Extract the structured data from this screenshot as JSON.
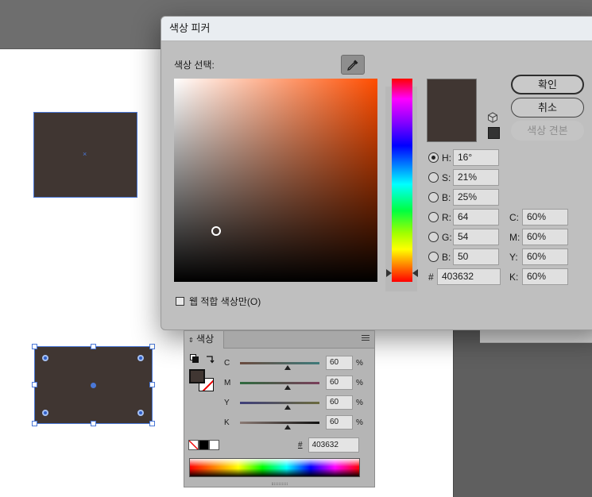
{
  "dialog": {
    "title": "색상 피커",
    "select_label": "색상 선택:",
    "ok_label": "확인",
    "cancel_label": "취소",
    "swatches_label": "색상 견본",
    "current_color": "#403632",
    "web_only_label": "웹 적합 색상만(O)",
    "fields": {
      "h": {
        "label": "H:",
        "value": "16°"
      },
      "s": {
        "label": "S:",
        "value": "21%"
      },
      "b": {
        "label": "B:",
        "value": "25%"
      },
      "r": {
        "label": "R:",
        "value": "64"
      },
      "g": {
        "label": "G:",
        "value": "54"
      },
      "bl": {
        "label": "B:",
        "value": "50"
      },
      "c": {
        "label": "C:",
        "value": "60%"
      },
      "m": {
        "label": "M:",
        "value": "60%"
      },
      "y": {
        "label": "Y:",
        "value": "60%"
      },
      "k": {
        "label": "K:",
        "value": "60%"
      },
      "hex": {
        "label": "#",
        "value": "403632"
      }
    }
  },
  "color_panel": {
    "tab_label": "색상",
    "sliders": [
      {
        "label": "C",
        "value": "60",
        "unit": "%"
      },
      {
        "label": "M",
        "value": "60",
        "unit": "%"
      },
      {
        "label": "Y",
        "value": "60",
        "unit": "%"
      },
      {
        "label": "K",
        "value": "60",
        "unit": "%"
      }
    ],
    "hex_label": "#",
    "hex_value": "403632"
  },
  "colors": {
    "fill": "#403632",
    "selection": "#4a78d8"
  }
}
